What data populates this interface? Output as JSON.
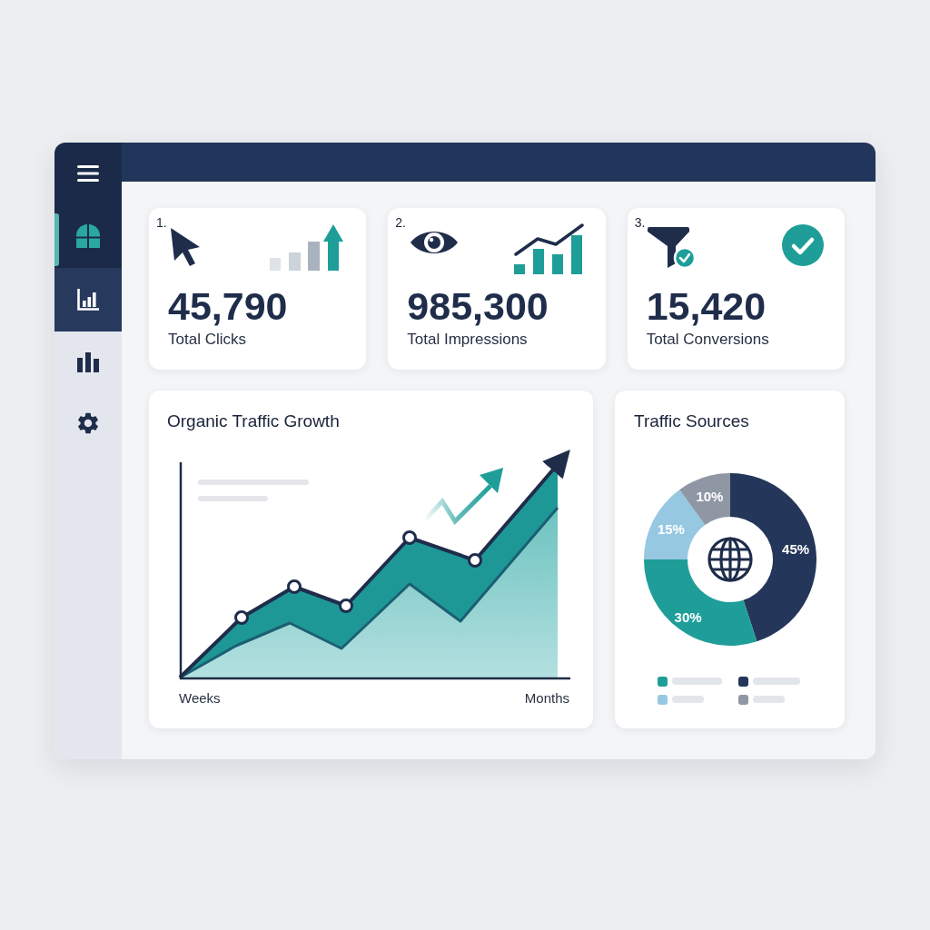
{
  "sidebar": {
    "primary": [
      {
        "selected": true
      },
      {
        "selected": false
      }
    ],
    "secondary": [
      {
        "selected": false
      },
      {
        "selected": false
      }
    ]
  },
  "stats": [
    {
      "index": "1.",
      "value": "45,790",
      "label": "Total Clicks"
    },
    {
      "index": "2.",
      "value": "985,300",
      "label": "Total Impressions"
    },
    {
      "index": "3.",
      "value": "15,420",
      "label": "Total Conversions"
    }
  ],
  "traffic_growth": {
    "title": "Organic Traffic Growth",
    "x_start_label": "Weeks",
    "x_end_label": "Months"
  },
  "traffic_sources": {
    "title": "Traffic Sources",
    "chart_data": {
      "type": "donut",
      "values": [
        45,
        30,
        15,
        10
      ],
      "value_labels": [
        "45%",
        "30%",
        "15%",
        "10%"
      ],
      "colors": [
        "#243659",
        "#1f9e99",
        "#97c8e2",
        "#8e97a3"
      ]
    },
    "legend": [
      {
        "color": "#1f9e99"
      },
      {
        "color": "#243659"
      },
      {
        "color": "#97c8e2"
      },
      {
        "color": "#8e97a3"
      }
    ]
  }
}
